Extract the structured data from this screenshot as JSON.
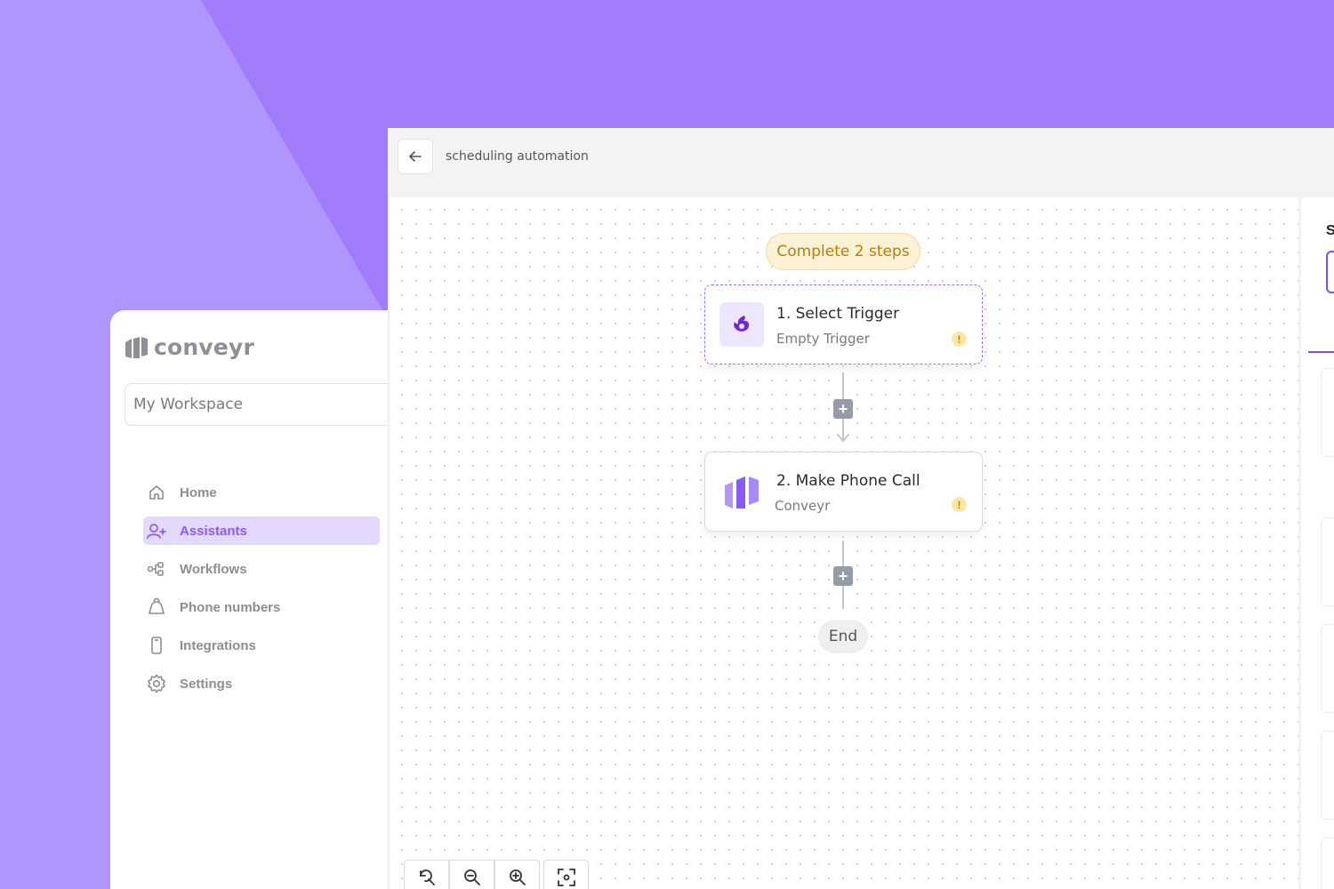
{
  "sidebar": {
    "logo_text": "conveyr",
    "workspace": "My Workspace",
    "items": [
      {
        "label": "Home",
        "icon": "home-icon",
        "active": false
      },
      {
        "label": "Assistants",
        "icon": "assistant-icon",
        "active": true
      },
      {
        "label": "Workflows",
        "icon": "workflow-icon",
        "active": false
      },
      {
        "label": "Phone numbers",
        "icon": "phone-icon",
        "active": false
      },
      {
        "label": "Integrations",
        "icon": "integration-icon",
        "active": false
      },
      {
        "label": "Settings",
        "icon": "gear-icon",
        "active": false
      }
    ]
  },
  "header": {
    "title": "scheduling automation",
    "back_icon": "arrow-left-icon"
  },
  "workflow": {
    "status_pill": "Complete 2 steps",
    "steps": [
      {
        "title": "1. Select Trigger",
        "subtitle": "Empty Trigger",
        "icon": "trigger-icon",
        "warning": "!"
      },
      {
        "title": "2. Make Phone Call",
        "subtitle": "Conveyr",
        "icon": "conveyr-logo-icon",
        "warning": "!"
      }
    ],
    "add_step_label": "+",
    "end_label": "End"
  },
  "right_panel": {
    "heading_fragment": "S"
  },
  "zoom_controls": [
    "reset-zoom-icon",
    "zoom-out-icon",
    "zoom-in-icon",
    "fit-view-icon"
  ],
  "colors": {
    "accent": "#8b5cf0",
    "background": "#a07cfb",
    "warning": "#c47f00",
    "status_pill_bg": "#fdf1d6"
  }
}
